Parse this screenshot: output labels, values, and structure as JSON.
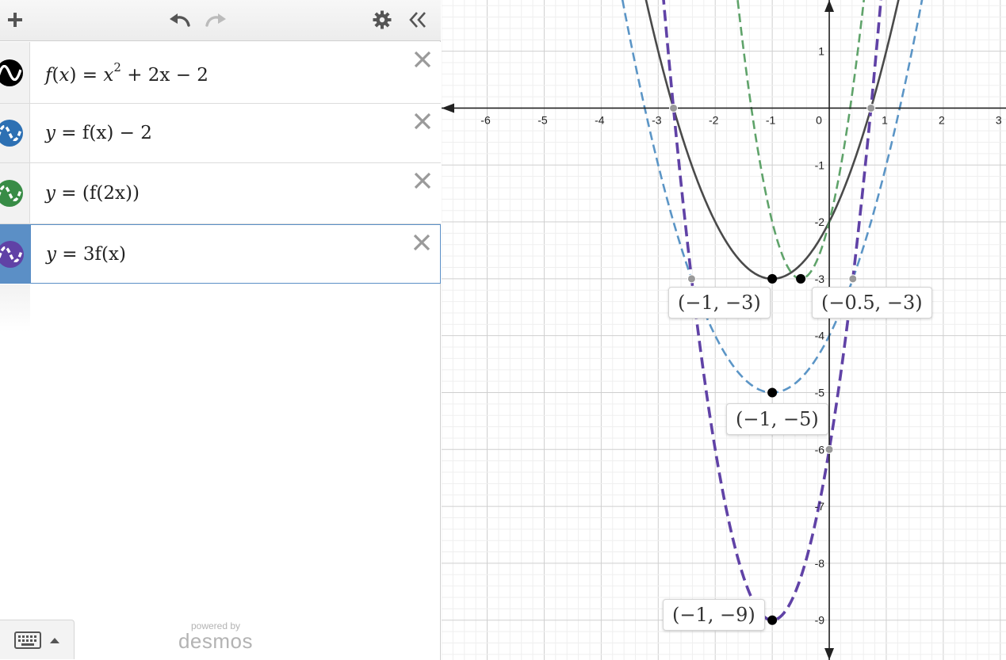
{
  "toolbar": {
    "add_icon": "plus-icon",
    "undo_icon": "undo-icon",
    "redo_icon": "redo-icon",
    "settings_icon": "gear-icon",
    "collapse_icon": "double-chevron-left-icon"
  },
  "expressions": [
    {
      "id": 1,
      "color": "#000000",
      "style": "solid",
      "f": "f",
      "x": "x",
      "rhs_prefix": " = ",
      "rhs": "x",
      "exp": "2",
      "tail": " + 2x − 2"
    },
    {
      "id": 2,
      "color": "#2d70b3",
      "style": "dashed",
      "lhs": "y",
      "eq": " = ",
      "body": "f(x) − 2"
    },
    {
      "id": 3,
      "color": "#388c46",
      "style": "dashed",
      "lhs": "y",
      "eq": " = ",
      "body": "(f(2x))"
    },
    {
      "id": 4,
      "color": "#6042a6",
      "style": "dashed",
      "lhs": "y",
      "eq": " = ",
      "body": "3f(x)",
      "selected": true
    }
  ],
  "brand": {
    "powered": "powered by",
    "logo": "desmos"
  },
  "graph": {
    "x_ticks": [
      "-6",
      "-5",
      "-4",
      "-3",
      "-2",
      "-1",
      "0",
      "1",
      "2",
      "3"
    ],
    "y_ticks": [
      "1",
      "-1",
      "-2",
      "-3",
      "-4",
      "-5",
      "-6",
      "-7",
      "-8",
      "-9"
    ],
    "labels": {
      "p1": "(−1, −3)",
      "p2": "(−0.5, −3)",
      "p3": "(−1, −5)",
      "p4": "(−1, −9)"
    }
  },
  "chart_data": {
    "type": "line",
    "xlim": [
      -6.8,
      3.1
    ],
    "ylim": [
      -9.7,
      1.9
    ],
    "grid": true,
    "series": [
      {
        "name": "f(x) = x^2 + 2x − 2",
        "color": "#4a4a4a",
        "style": "solid",
        "coef": [
          1,
          2,
          -2
        ]
      },
      {
        "name": "y = f(x) − 2",
        "color": "#5b95c6",
        "style": "dashed",
        "coef": [
          1,
          2,
          -4
        ]
      },
      {
        "name": "y = (f(2x))",
        "color": "#5fa36a",
        "style": "dashed",
        "coef": [
          4,
          4,
          -2
        ]
      },
      {
        "name": "y = 3f(x)",
        "color": "#6042a6",
        "style": "dashed",
        "coef": [
          3,
          6,
          -6
        ]
      }
    ],
    "points": [
      {
        "x": -1,
        "y": -3,
        "color": "#000000",
        "label": "(−1, −3)"
      },
      {
        "x": -0.5,
        "y": -3,
        "color": "#000000",
        "label": "(−0.5, −3)"
      },
      {
        "x": -1,
        "y": -5,
        "color": "#000000",
        "label": "(−1, −5)"
      },
      {
        "x": -1,
        "y": -9,
        "color": "#000000",
        "label": "(−1, −9)"
      },
      {
        "x": -2.732,
        "y": 0,
        "color": "#999999"
      },
      {
        "x": 0.732,
        "y": 0,
        "color": "#999999"
      },
      {
        "x": -2.414,
        "y": -3,
        "color": "#999999"
      },
      {
        "x": 0.414,
        "y": -3,
        "color": "#999999"
      },
      {
        "x": 0,
        "y": -6,
        "color": "#999999"
      }
    ]
  }
}
